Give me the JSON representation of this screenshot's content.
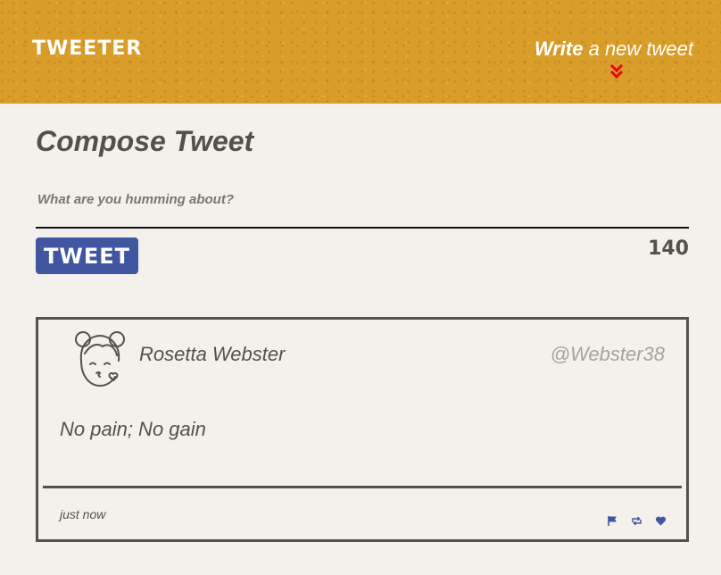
{
  "header": {
    "brand": "TWEETER",
    "write_strong": "Write",
    "write_rest": "a new tweet",
    "chevron_icon": "double-chevron-down",
    "chevron_color": "#e3090b",
    "background": "#d99d2a"
  },
  "compose": {
    "title": "Compose Tweet",
    "placeholder": "What are you humming about?",
    "button_label": "TWEET",
    "counter": "140",
    "button_color": "#4056a1"
  },
  "tweet": {
    "avatar_icon": "kissing-girl-avatar",
    "name": "Rosetta Webster",
    "handle": "@Webster38",
    "content": "No pain; No gain",
    "timestamp": "just now",
    "actions": [
      {
        "name": "flag",
        "icon": "flag-icon"
      },
      {
        "name": "retweet",
        "icon": "retweet-icon"
      },
      {
        "name": "like",
        "icon": "heart-icon"
      }
    ],
    "action_color": "#4056a1"
  }
}
